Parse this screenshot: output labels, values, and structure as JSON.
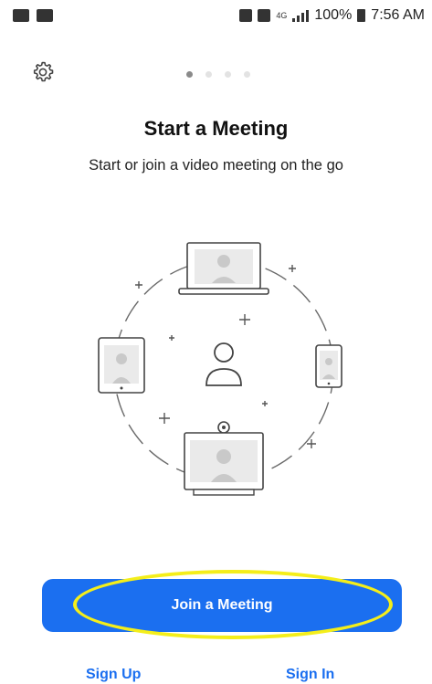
{
  "status_bar": {
    "network": "4G",
    "battery_percent": "100%",
    "time": "7:56 AM"
  },
  "onboarding": {
    "page_indicator": {
      "total": 4,
      "active_index": 0
    },
    "title": "Start a Meeting",
    "subtitle": "Start or join a video meeting on the go"
  },
  "actions": {
    "join_label": "Join a Meeting",
    "sign_up_label": "Sign Up",
    "sign_in_label": "Sign In"
  },
  "colors": {
    "accent": "#1b6ff0",
    "highlight": "#f4ee1a"
  }
}
